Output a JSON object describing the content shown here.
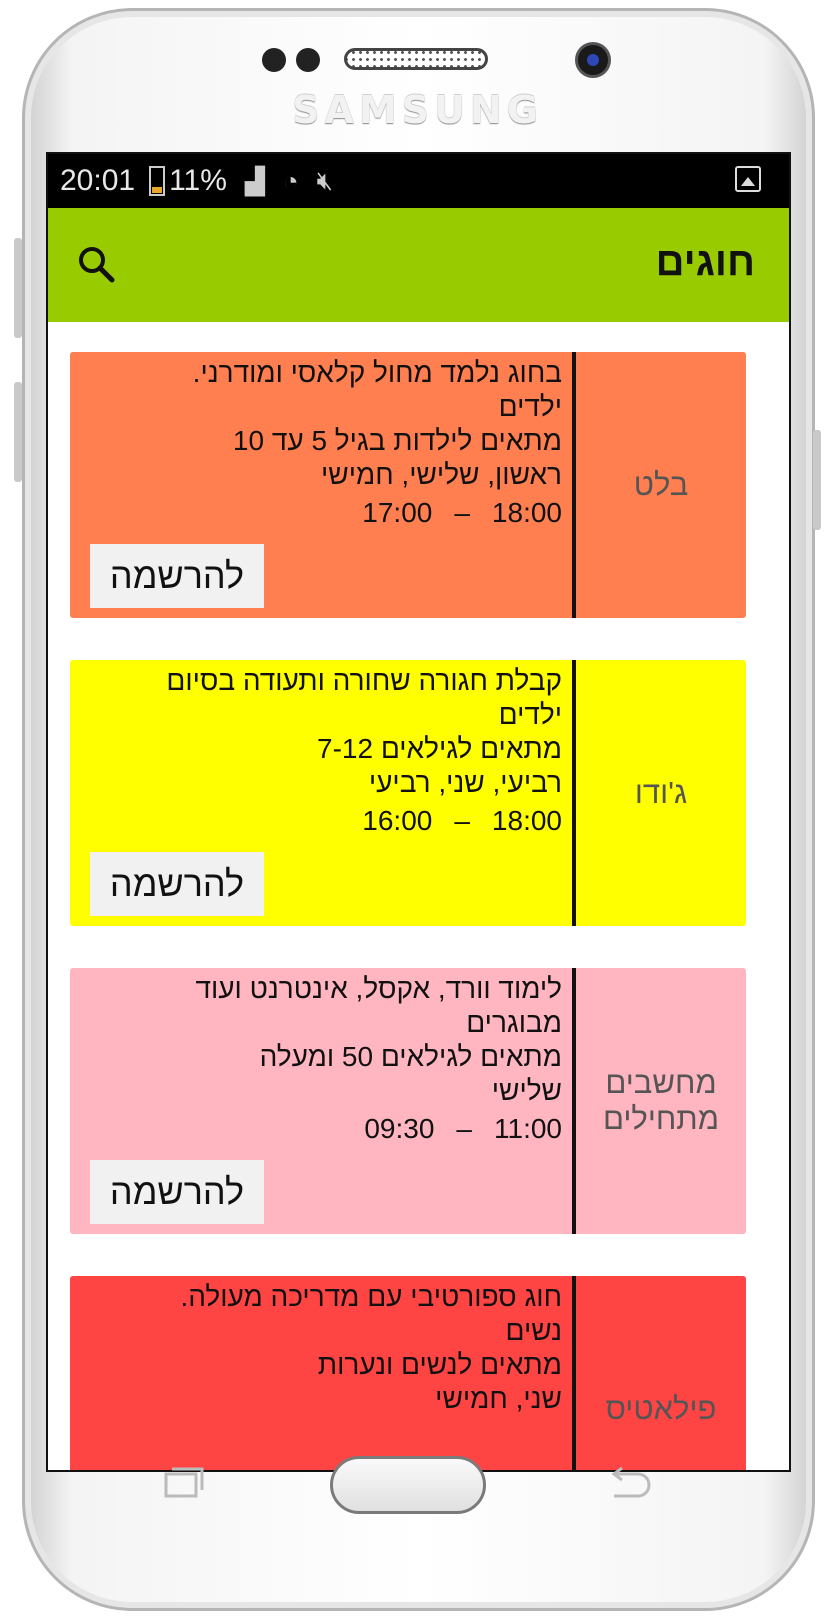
{
  "device": {
    "brand": "SAMSUNG"
  },
  "status_bar": {
    "time": "20:01",
    "battery_percent": "11%"
  },
  "app_bar": {
    "title": "חוגים",
    "search_icon": "search-icon"
  },
  "courses": [
    {
      "name": "בלט",
      "color": "#ff7f50",
      "description": "בחוג נלמד מחול קלאסי ומודרני.",
      "audience": "ילדים",
      "ages": "מתאים לילדות בגיל 5 עד 10",
      "days": "ראשון, שלישי, חמישי",
      "time_start": "17:00",
      "time_end": "18:00",
      "register_label": "להרשמה"
    },
    {
      "name": "ג'ודו",
      "color": "#ffff00",
      "description": "קבלת חגורה שחורה ותעודה בסיום",
      "audience": "ילדים",
      "ages": "מתאים לגילאים 7-12",
      "days": "רביעי, שני, רביעי",
      "time_start": "16:00",
      "time_end": "18:00",
      "register_label": "להרשמה"
    },
    {
      "name": "מחשבים מתחילים",
      "color": "#ffb6c1",
      "description": "לימוד וורד, אקסל, אינטרנט ועוד",
      "audience": "מבוגרים",
      "ages": "מתאים לגילאים 50 ומעלה",
      "days": "שלישי",
      "time_start": "09:30",
      "time_end": "11:00",
      "register_label": "להרשמה"
    },
    {
      "name": "פילאטיס",
      "color": "#ff4444",
      "description": "חוג ספורטיבי עם מדריכה מעולה.",
      "audience": "נשים",
      "ages": "מתאים לנשים ונערות",
      "days": "שני, חמישי"
    }
  ]
}
